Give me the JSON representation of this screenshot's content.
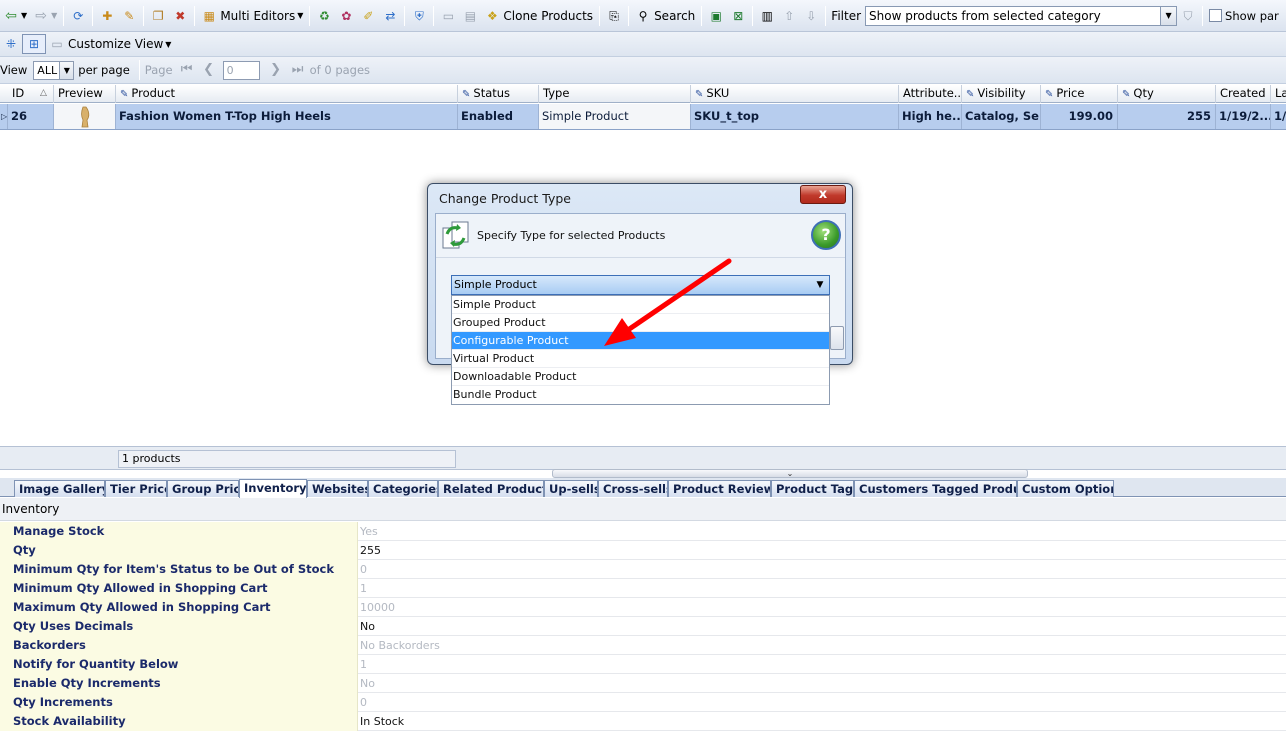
{
  "toolbar": {
    "multi_editors_label": "Multi Editors",
    "clone_products_label": "Clone Products",
    "search_label": "Search",
    "filter_label": "Filter",
    "filter_value": "Show products from selected category",
    "show_params_label": "Show par"
  },
  "toolbar2": {
    "customize_view_label": "Customize View"
  },
  "pager": {
    "view_label": "View",
    "per_page_value": "ALL",
    "per_page_label": "per page",
    "page_label": "Page",
    "page_value": "0",
    "of_pages_label": "of 0 pages"
  },
  "grid": {
    "columns": [
      "ID",
      "Preview",
      "Product",
      "Status",
      "Type",
      "SKU",
      "Attribute...",
      "Visibility",
      "Price",
      "Qty",
      "Created",
      "La"
    ],
    "row": {
      "id": "26",
      "product": "Fashion Women T-Top High Heels",
      "status": "Enabled",
      "type": "Simple Product",
      "sku": "SKU_t_top",
      "attribute": "High he...",
      "visibility": "Catalog, Se...",
      "price": "199.00",
      "qty": "255",
      "created": "1/19/2...",
      "last": "1/"
    }
  },
  "status_bar": {
    "count_text": "1 products"
  },
  "tabs": [
    "Image Gallery",
    "Tier Price",
    "Group Price",
    "Inventory",
    "Websites",
    "Categories",
    "Related Products",
    "Up-sells",
    "Cross-sells",
    "Product Reviews",
    "Product Tags",
    "Customers Tagged Product",
    "Custom Options"
  ],
  "inventory": {
    "title": "Inventory",
    "rows": [
      {
        "label": "Manage Stock",
        "value": "Yes"
      },
      {
        "label": "Qty",
        "value": "255"
      },
      {
        "label": "Minimum Qty for Item's Status to be Out of Stock",
        "value": "0"
      },
      {
        "label": "Minimum Qty Allowed in Shopping Cart",
        "value": "1"
      },
      {
        "label": "Maximum Qty Allowed in Shopping Cart",
        "value": "10000"
      },
      {
        "label": "Qty Uses Decimals",
        "value": "No"
      },
      {
        "label": "Backorders",
        "value": "No Backorders"
      },
      {
        "label": "Notify for Quantity Below",
        "value": "1"
      },
      {
        "label": "Enable Qty Increments",
        "value": "No"
      },
      {
        "label": "Qty Increments",
        "value": "0"
      },
      {
        "label": "Stock Availability",
        "value": "In Stock"
      }
    ]
  },
  "dialog": {
    "title": "Change Product Type",
    "close_label": "x",
    "heading": "Specify Type for selected Products",
    "help_label": "?",
    "combo_value": "Simple Product",
    "options": [
      "Simple Product",
      "Grouped Product",
      "Configurable Product",
      "Virtual Product",
      "Downloadable Product",
      "Bundle Product"
    ],
    "highlighted_option": "Configurable Product"
  },
  "colors": {
    "selected_row": "#b7cdee",
    "highlight": "#3399ff",
    "arrow": "#ff0000",
    "inventory_label_bg": "#fbfbe3"
  }
}
